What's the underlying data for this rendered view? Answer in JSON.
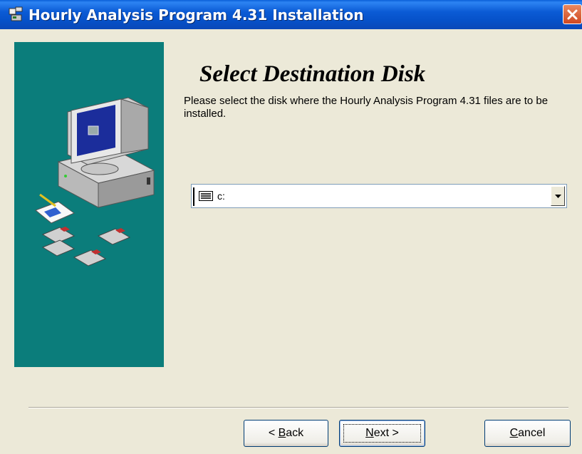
{
  "window": {
    "title": "Hourly Analysis Program 4.31 Installation",
    "icon": "setup-icon",
    "close_icon": "close-icon"
  },
  "left_panel": {
    "illustration": "computer-with-floppy-disks",
    "background_color": "#0b7d7b"
  },
  "content": {
    "heading": "Select Destination Disk",
    "description": "Please select the disk where the Hourly Analysis Program 4.31 files are to be installed."
  },
  "drive_select": {
    "icon": "drive-icon",
    "selected": "c:",
    "dropdown_icon": "chevron-down-icon"
  },
  "buttons": {
    "back": {
      "pre": "< ",
      "mnemonic": "B",
      "rest": "ack"
    },
    "next": {
      "mnemonic": "N",
      "rest": "ext >"
    },
    "cancel": {
      "mnemonic": "C",
      "rest": "ancel"
    }
  }
}
